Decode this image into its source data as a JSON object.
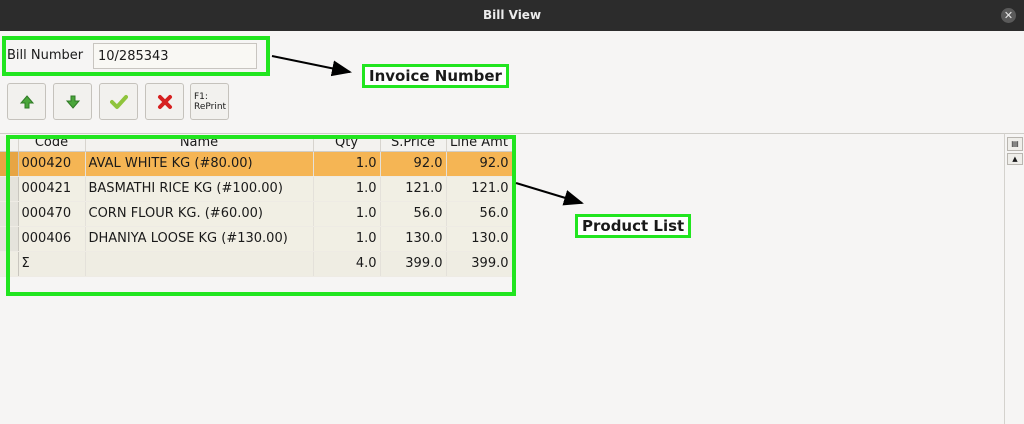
{
  "window": {
    "title": "Bill View",
    "close_glyph": "✕"
  },
  "bill": {
    "label": "Bill Number",
    "value": "10/285343"
  },
  "toolbar": {
    "buttons": [
      {
        "icon": "arrow-up-icon",
        "color": "#4aa63a"
      },
      {
        "icon": "arrow-down-icon",
        "color": "#4aa63a"
      },
      {
        "icon": "checkmark-icon",
        "color": "#8fc43c"
      },
      {
        "icon": "cancel-icon",
        "color": "#d62020"
      }
    ],
    "reprint_line1": "F1:",
    "reprint_line2": "RePrint"
  },
  "table": {
    "columns": [
      "Code",
      "Name",
      "Qty",
      "S.Price",
      "Line Amt"
    ],
    "rows": [
      {
        "code": "000420",
        "name": "AVAL WHITE  KG (#80.00)",
        "qty": "1.0",
        "price": "92.0",
        "amt": "92.0",
        "selected": true
      },
      {
        "code": "000421",
        "name": "BASMATHI RICE KG (#100.00)",
        "qty": "1.0",
        "price": "121.0",
        "amt": "121.0"
      },
      {
        "code": "000470",
        "name": "CORN FLOUR KG. (#60.00)",
        "qty": "1.0",
        "price": "56.0",
        "amt": "56.0"
      },
      {
        "code": "000406",
        "name": "DHANIYA LOOSE KG (#130.00)",
        "qty": "1.0",
        "price": "130.0",
        "amt": "130.0"
      }
    ],
    "total": {
      "label": "Σ",
      "qty": "4.0",
      "price": "399.0",
      "amt": "399.0"
    }
  },
  "annotations": {
    "invoice_number": "Invoice Number",
    "product_list": "Product List",
    "highlight_color": "#21e51f"
  },
  "colors": {
    "selected_row": "#f5b554",
    "titlebar": "#2c2c2c"
  }
}
